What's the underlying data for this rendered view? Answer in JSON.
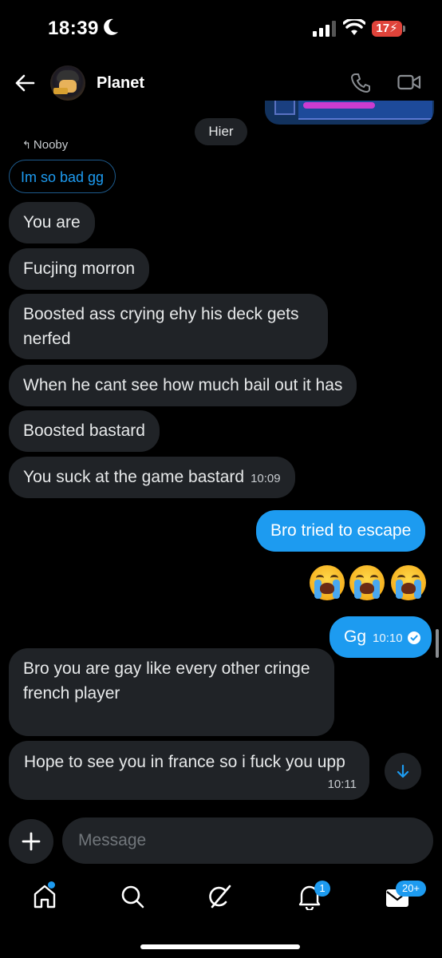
{
  "status_bar": {
    "time": "18:39",
    "battery": "17"
  },
  "header": {
    "title": "Planet"
  },
  "chat": {
    "day_separator": "Hier",
    "reply_context": {
      "author": "Nooby",
      "quoted": "Im so bad gg"
    },
    "messages": [
      {
        "text": "You are",
        "from": "them"
      },
      {
        "text": "Fucjing morron",
        "from": "them"
      },
      {
        "text": "Boosted ass crying ehy his deck gets nerfed",
        "from": "them"
      },
      {
        "text": "When he cant see how much bail out it has",
        "from": "them"
      },
      {
        "text": "Boosted bastard",
        "from": "them"
      },
      {
        "text": "You suck at the game bastard",
        "from": "them",
        "time": "10:09"
      },
      {
        "text": "Bro tried to escape",
        "from": "me"
      },
      {
        "text": "😭😭😭",
        "from": "me",
        "kind": "emoji"
      },
      {
        "text": "Gg",
        "from": "me",
        "time": "10:10",
        "status": "read"
      },
      {
        "text": "Bro you are gay like every other cringe french player",
        "from": "them"
      },
      {
        "text": "Hope to see you in france so i fuck you upp",
        "from": "them",
        "time": "10:11"
      }
    ]
  },
  "composer": {
    "placeholder": "Message"
  },
  "nav": {
    "notifications_badge": "1",
    "messages_badge": "20+"
  },
  "colors": {
    "accent": "#1d9bf0",
    "bubble": "#202327",
    "background": "#000000"
  }
}
